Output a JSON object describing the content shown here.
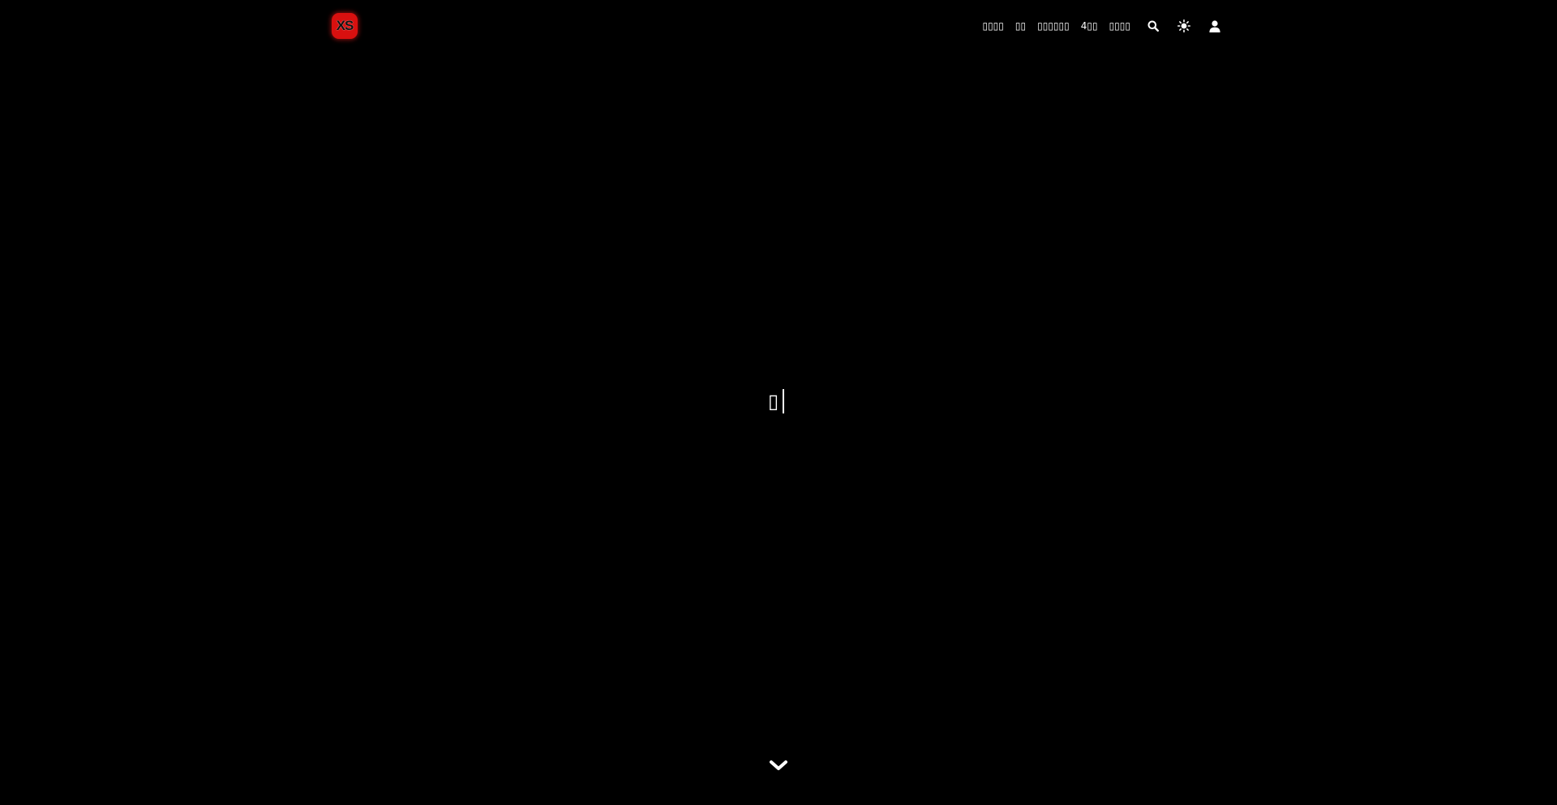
{
  "header": {
    "logo_text": "XS",
    "nav": [
      {
        "label": "▯▯▯▯"
      },
      {
        "label": "▯▯"
      },
      {
        "label": "▯▯▯▯▯▯"
      },
      {
        "label": "4▯▯"
      },
      {
        "label": "▯▯▯▯"
      }
    ],
    "icons": [
      "search-icon",
      "sun-icon",
      "user-icon"
    ]
  },
  "hero": {
    "typed_text": "▯"
  },
  "scroll": {
    "icon": "chevron-down-icon"
  },
  "colors": {
    "background": "#000000",
    "logo_bg": "#d8100f",
    "text": "#ffffff"
  }
}
